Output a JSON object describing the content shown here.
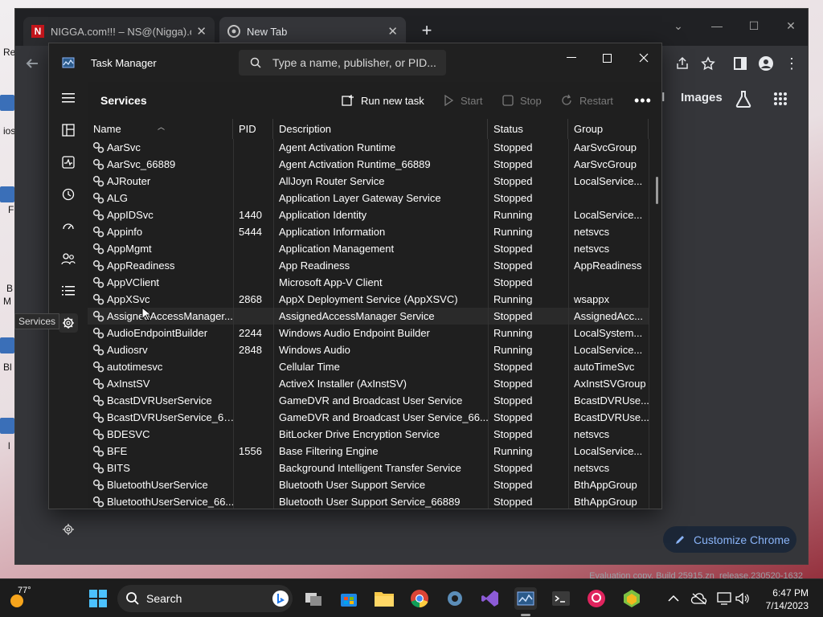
{
  "browser": {
    "tabs": [
      {
        "favicon": "N",
        "title": "NIGGA.com!!! – NS@(Nigga).com"
      },
      {
        "favicon": "chrome-icon",
        "title": "New Tab"
      }
    ],
    "ntp_links": [
      "il",
      "Images"
    ],
    "customize_label": "Customize Chrome",
    "watermark": "Evaluation copy. Build 25915.zn_release.230520-1632"
  },
  "desktop_fragments": [
    "Re",
    "ios",
    "F",
    "B",
    "M",
    "Bl",
    "l"
  ],
  "taskmanager": {
    "title": "Task Manager",
    "search_placeholder": "Type a name, publisher, or PID...",
    "page_title": "Services",
    "toolbar": {
      "run_new_task": "Run new task",
      "start": "Start",
      "stop": "Stop",
      "restart": "Restart"
    },
    "tooltip": "Services",
    "columns": [
      "Name",
      "PID",
      "Description",
      "Status",
      "Group"
    ],
    "rows": [
      {
        "name": "AarSvc",
        "pid": "",
        "description": "Agent Activation Runtime",
        "status": "Stopped",
        "group": "AarSvcGroup"
      },
      {
        "name": "AarSvc_66889",
        "pid": "",
        "description": "Agent Activation Runtime_66889",
        "status": "Stopped",
        "group": "AarSvcGroup"
      },
      {
        "name": "AJRouter",
        "pid": "",
        "description": "AllJoyn Router Service",
        "status": "Stopped",
        "group": "LocalService..."
      },
      {
        "name": "ALG",
        "pid": "",
        "description": "Application Layer Gateway Service",
        "status": "Stopped",
        "group": ""
      },
      {
        "name": "AppIDSvc",
        "pid": "1440",
        "description": "Application Identity",
        "status": "Running",
        "group": "LocalService..."
      },
      {
        "name": "Appinfo",
        "pid": "5444",
        "description": "Application Information",
        "status": "Running",
        "group": "netsvcs"
      },
      {
        "name": "AppMgmt",
        "pid": "",
        "description": "Application Management",
        "status": "Stopped",
        "group": "netsvcs"
      },
      {
        "name": "AppReadiness",
        "pid": "",
        "description": "App Readiness",
        "status": "Stopped",
        "group": "AppReadiness"
      },
      {
        "name": "AppVClient",
        "pid": "",
        "description": "Microsoft App-V Client",
        "status": "Stopped",
        "group": ""
      },
      {
        "name": "AppXSvc",
        "pid": "2868",
        "description": "AppX Deployment Service (AppXSVC)",
        "status": "Running",
        "group": "wsappx"
      },
      {
        "name": "AssignedAccessManager...",
        "pid": "",
        "description": "AssignedAccessManager Service",
        "status": "Stopped",
        "group": "AssignedAcc..."
      },
      {
        "name": "AudioEndpointBuilder",
        "pid": "2244",
        "description": "Windows Audio Endpoint Builder",
        "status": "Running",
        "group": "LocalSystem..."
      },
      {
        "name": "Audiosrv",
        "pid": "2848",
        "description": "Windows Audio",
        "status": "Running",
        "group": "LocalService..."
      },
      {
        "name": "autotimesvc",
        "pid": "",
        "description": "Cellular Time",
        "status": "Stopped",
        "group": "autoTimeSvc"
      },
      {
        "name": "AxInstSV",
        "pid": "",
        "description": "ActiveX Installer (AxInstSV)",
        "status": "Stopped",
        "group": "AxInstSVGroup"
      },
      {
        "name": "BcastDVRUserService",
        "pid": "",
        "description": "GameDVR and Broadcast User Service",
        "status": "Stopped",
        "group": "BcastDVRUse..."
      },
      {
        "name": "BcastDVRUserService_66...",
        "pid": "",
        "description": "GameDVR and Broadcast User Service_66...",
        "status": "Stopped",
        "group": "BcastDVRUse..."
      },
      {
        "name": "BDESVC",
        "pid": "",
        "description": "BitLocker Drive Encryption Service",
        "status": "Stopped",
        "group": "netsvcs"
      },
      {
        "name": "BFE",
        "pid": "1556",
        "description": "Base Filtering Engine",
        "status": "Running",
        "group": "LocalService..."
      },
      {
        "name": "BITS",
        "pid": "",
        "description": "Background Intelligent Transfer Service",
        "status": "Stopped",
        "group": "netsvcs"
      },
      {
        "name": "BluetoothUserService",
        "pid": "",
        "description": "Bluetooth User Support Service",
        "status": "Stopped",
        "group": "BthAppGroup"
      },
      {
        "name": "BluetoothUserService_66...",
        "pid": "",
        "description": "Bluetooth User Support Service_66889",
        "status": "Stopped",
        "group": "BthAppGroup"
      }
    ]
  },
  "taskbar": {
    "weather_temp": "77°",
    "search_label": "Search",
    "time": "6:47 PM",
    "date": "7/14/2023"
  },
  "colors": {
    "accent": "#8ab4f8",
    "tm_bg": "#1f1f1f",
    "taskbar": "#1c1c1c"
  }
}
